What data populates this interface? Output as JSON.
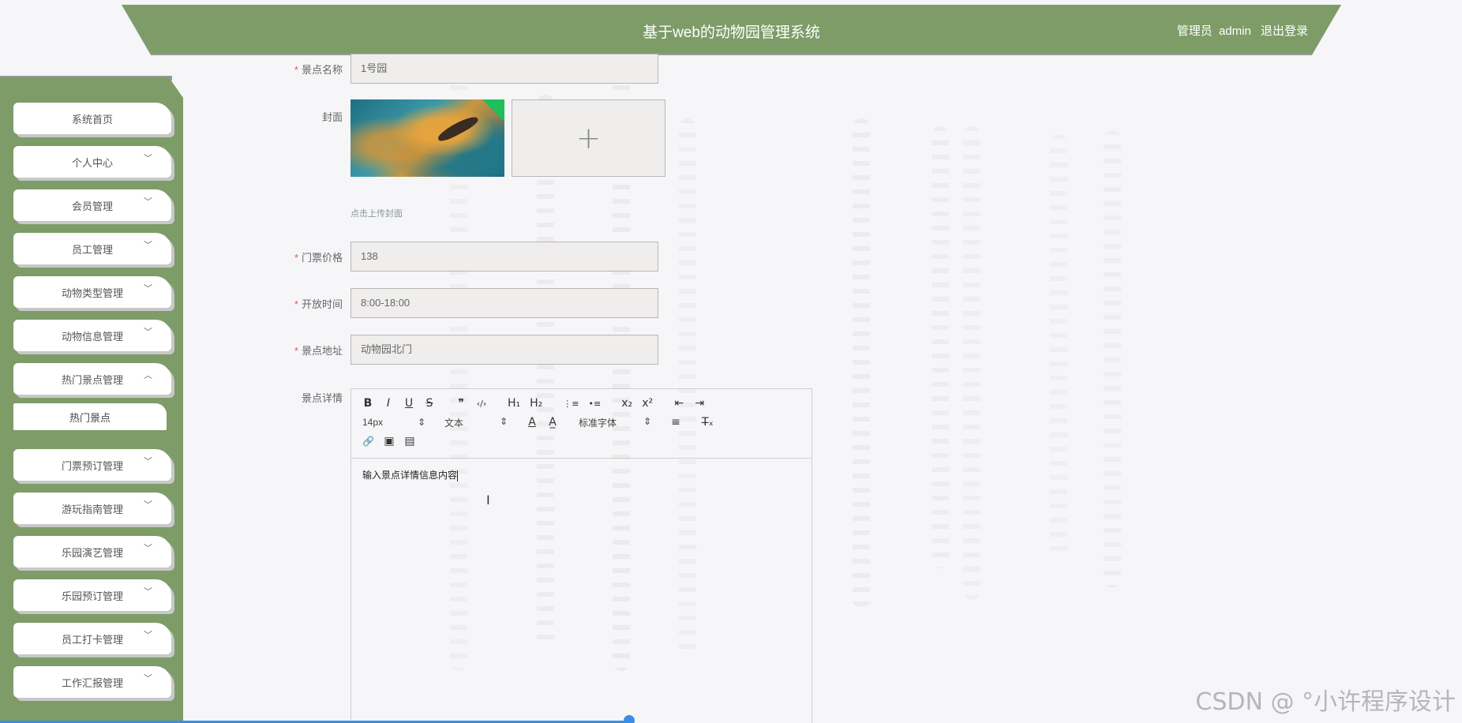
{
  "header": {
    "title": "基于web的动物园管理系统",
    "role": "管理员",
    "username": "admin",
    "logout": "退出登录"
  },
  "sidebar": {
    "items": [
      {
        "label": "系统首页",
        "has_chevron": false
      },
      {
        "label": "个人中心",
        "has_chevron": true
      },
      {
        "label": "会员管理",
        "has_chevron": true
      },
      {
        "label": "员工管理",
        "has_chevron": true
      },
      {
        "label": "动物类型管理",
        "has_chevron": true
      },
      {
        "label": "动物信息管理",
        "has_chevron": true
      },
      {
        "label": "热门景点管理",
        "has_chevron": true,
        "expanded": true
      },
      {
        "label": "门票预订管理",
        "has_chevron": true
      },
      {
        "label": "游玩指南管理",
        "has_chevron": true
      },
      {
        "label": "乐园演艺管理",
        "has_chevron": true
      },
      {
        "label": "乐园预订管理",
        "has_chevron": true
      },
      {
        "label": "员工打卡管理",
        "has_chevron": true
      },
      {
        "label": "工作汇报管理",
        "has_chevron": true
      }
    ],
    "sub_item": "热门景点"
  },
  "form": {
    "name_label": "景点名称",
    "name_value": "1号园",
    "cover_label": "封面",
    "cover_hint": "点击上传封面",
    "upload_plus": "+",
    "price_label": "门票价格",
    "price_value": "138",
    "hours_label": "开放时间",
    "hours_value": "8:00-18:00",
    "address_label": "景点地址",
    "address_value": "动物园北门",
    "details_label": "景点详情",
    "required_mark": "*"
  },
  "editor": {
    "font_size": "14px",
    "block_type": "文本",
    "font_family": "标准字体",
    "content": "输入景点详情信息内容",
    "buttons": {
      "bold": "B",
      "italic": "I",
      "underline": "U",
      "strike": "S",
      "quote": "❞",
      "code": "‹/›",
      "h1": "H₁",
      "h2": "H₂",
      "ol": "⋮≡",
      "ul": "•≡",
      "sub": "x₂",
      "sup": "x²",
      "outdent": "⇤",
      "indent": "⇥",
      "color": "A",
      "background": "A̲",
      "align": "≡",
      "clear": "T̶ₓ",
      "link": "🔗",
      "image": "▣",
      "video": "▤"
    },
    "select_arrow": "⇕"
  },
  "watermark": "CSDN @ °小许程序设计",
  "colors": {
    "primary": "#7d9c68",
    "required": "#e05a4f",
    "scroll": "#3a8ee6"
  }
}
